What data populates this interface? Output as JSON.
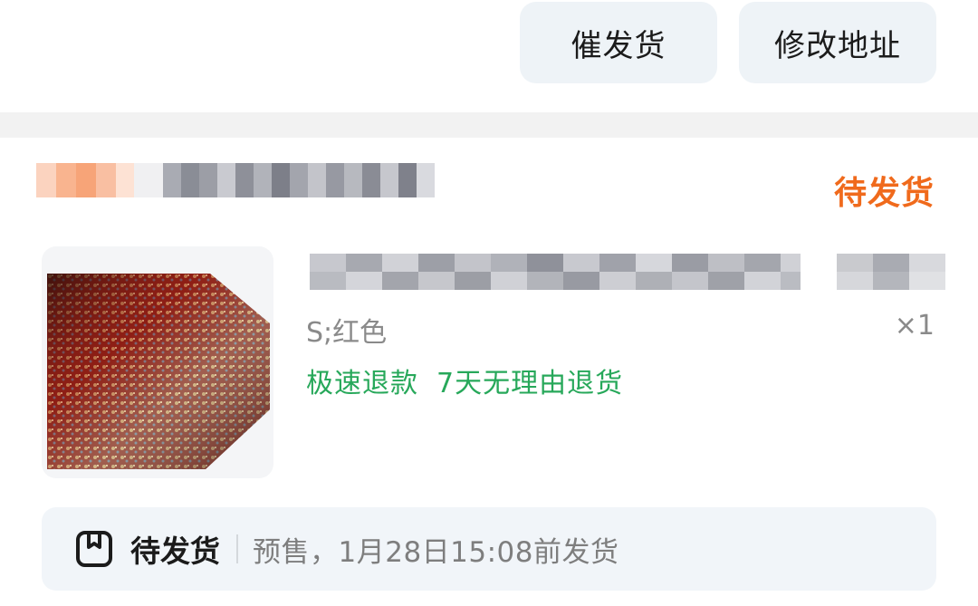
{
  "actions": {
    "urge_label": "催发货",
    "modify_address_label": "修改地址"
  },
  "order": {
    "status": "待发货"
  },
  "product": {
    "thumbnail_icon": "product-photo-icon",
    "sku": "S;红色",
    "quantity": "×1",
    "tags": [
      "极速退款",
      "7天无理由退货"
    ]
  },
  "shipping": {
    "icon": "package-icon",
    "status": "待发货",
    "detail": "预售，1月28日15:08前发货"
  },
  "colors": {
    "status_orange": "#f06a1c",
    "tag_green": "#27a85a",
    "button_bg": "#eef3f7"
  }
}
